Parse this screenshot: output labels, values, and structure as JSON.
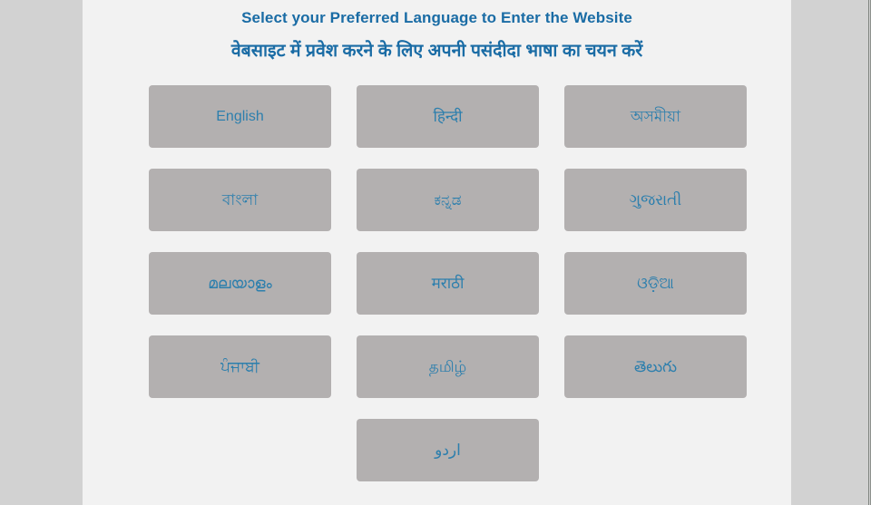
{
  "page": {
    "heading_en": "Select your Preferred Language to Enter the Website",
    "heading_hi": "वेबसाइट में प्रवेश करने के लिए अपनी पसंदीदा भाषा का चयन करें"
  },
  "colors": {
    "heading_blue": "#1a6ca5",
    "button_text_blue": "#2d7fad",
    "button_fill": "#b3b0b0",
    "page_background": "#f2f2f2",
    "gutter_background": "#d2d2d2"
  },
  "languages": [
    {
      "label": "English",
      "name": "english"
    },
    {
      "label": "हिन्दी",
      "name": "hindi"
    },
    {
      "label": "অসমীয়া",
      "name": "assamese"
    },
    {
      "label": "বাংলা",
      "name": "bengali"
    },
    {
      "label": "ಕನ್ನಡ",
      "name": "kannada"
    },
    {
      "label": "ગુજરાતી",
      "name": "gujarati"
    },
    {
      "label": "മലയാളം",
      "name": "malayalam"
    },
    {
      "label": "मराठी",
      "name": "marathi"
    },
    {
      "label": "ଓଡ଼ିଆ",
      "name": "odia"
    },
    {
      "label": "ਪੰਜਾਬੀ",
      "name": "punjabi"
    },
    {
      "label": "தமிழ்",
      "name": "tamil"
    },
    {
      "label": "తెలుగు",
      "name": "telugu"
    },
    {
      "label": "اردو",
      "name": "urdu"
    }
  ]
}
